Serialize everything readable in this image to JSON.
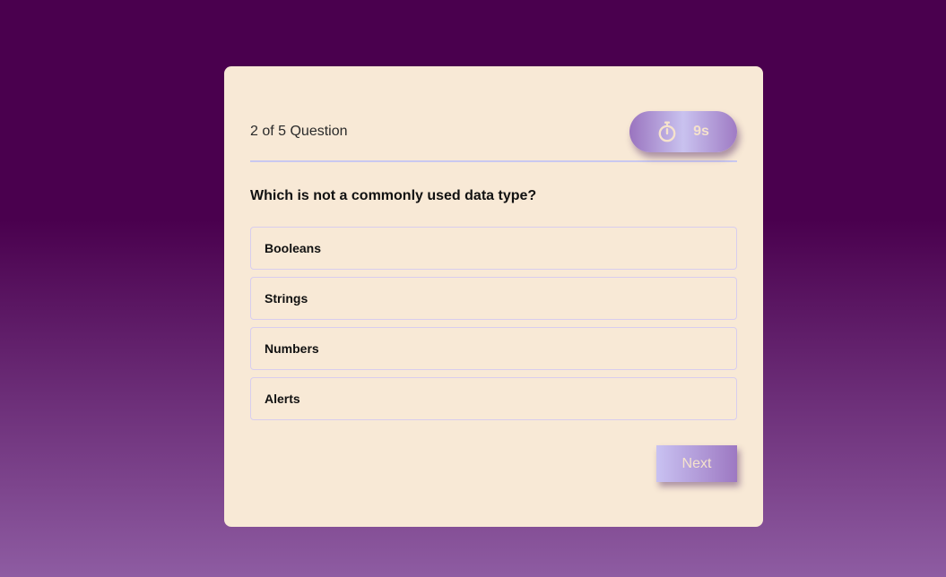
{
  "quiz": {
    "progress": "2 of 5 Question",
    "timer": {
      "icon": "stopwatch-icon",
      "value": "9s"
    },
    "question": "Which is not a commonly used data type?",
    "options": [
      {
        "label": "Booleans"
      },
      {
        "label": "Strings"
      },
      {
        "label": "Numbers"
      },
      {
        "label": "Alerts"
      }
    ],
    "next_label": "Next"
  },
  "colors": {
    "background_top": "#4a004e",
    "background_bottom": "#8e5ca2",
    "card": "#f8e9d6",
    "accent": "#9d78c2",
    "accent_light": "#c9c2f2",
    "button_text": "#f5e2cc"
  }
}
